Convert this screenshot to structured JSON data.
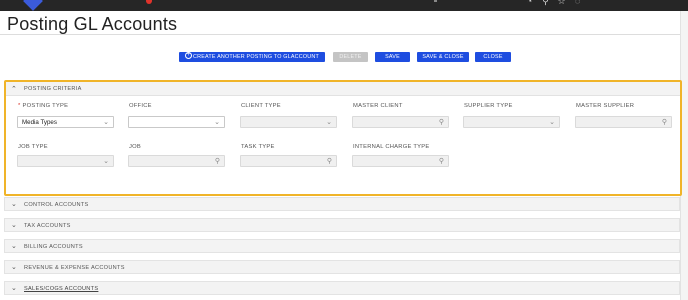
{
  "page": {
    "title": "Posting GL Accounts"
  },
  "actions": {
    "create_label": "CREATE ANOTHER POSTING TO GLACCOUNT",
    "delete_label": "DELETE",
    "save_label": "SAVE",
    "save_close_label": "SAVE & CLOSE",
    "close_label": "CLOSE"
  },
  "criteria": {
    "header": "POSTING CRITERIA",
    "required_mark": "*",
    "fields": {
      "posting_type": {
        "label": "POSTING TYPE",
        "value": "Media Types"
      },
      "office": {
        "label": "OFFICE",
        "value": ""
      },
      "client_type": {
        "label": "CLIENT TYPE",
        "value": ""
      },
      "master_client": {
        "label": "MASTER CLIENT",
        "value": ""
      },
      "supplier_type": {
        "label": "SUPPLIER TYPE",
        "value": ""
      },
      "master_supplier": {
        "label": "MASTER SUPPLIER",
        "value": ""
      },
      "job_type": {
        "label": "JOB TYPE",
        "value": ""
      },
      "job": {
        "label": "JOB",
        "value": ""
      },
      "task_type": {
        "label": "TASK TYPE",
        "value": ""
      },
      "internal_charge_type": {
        "label": "INTERNAL CHARGE TYPE",
        "value": ""
      }
    }
  },
  "sections": [
    {
      "label": "CONTROL ACCOUNTS"
    },
    {
      "label": "TAX ACCOUNTS"
    },
    {
      "label": "BILLING ACCOUNTS"
    },
    {
      "label": "REVENUE & EXPENSE ACCOUNTS"
    },
    {
      "label": "SALES/COGS ACCOUNTS"
    }
  ],
  "icons": {
    "chevron_down": "⌄",
    "chevron_up": "⌃",
    "search": "⚲",
    "plus": "+"
  },
  "colors": {
    "primary": "#1e4de0",
    "highlight_border": "#f0b429",
    "required": "#d93025"
  }
}
